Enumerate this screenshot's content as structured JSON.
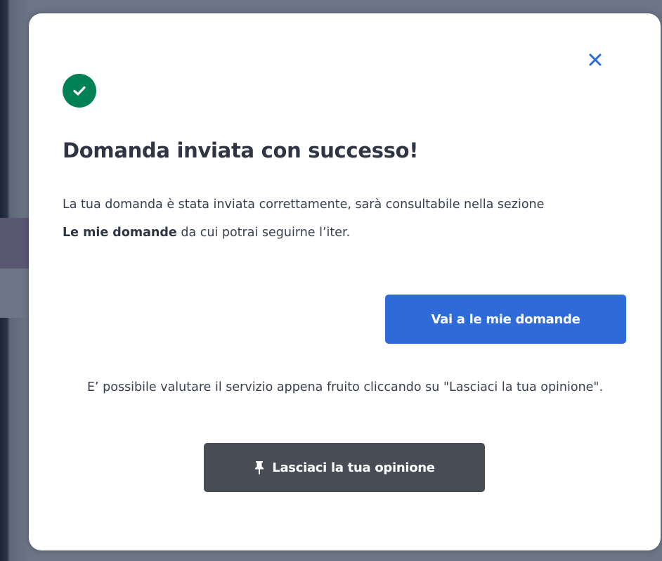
{
  "modal": {
    "title": "Domanda inviata con successo!",
    "message_part1": "La tua domanda è stata inviata correttamente, sarà consultabile nella sezione ",
    "message_bold": "Le mie domande",
    "message_part2": " da cui potrai seguirne l’iter.",
    "primary_button_label": "Vai a le mie domande",
    "rating_text": "E’ possibile valutare il servizio appena fruito cliccando su \"Lasciaci la tua opinione\".",
    "secondary_button_label": "Lasciaci la tua opinione",
    "icons": {
      "close": "close-icon",
      "success": "check-icon",
      "pin": "pin-icon"
    }
  },
  "colors": {
    "success": "#008055",
    "primary": "#2f6bd8",
    "secondary": "#474c55",
    "close": "#2f6bd8"
  }
}
